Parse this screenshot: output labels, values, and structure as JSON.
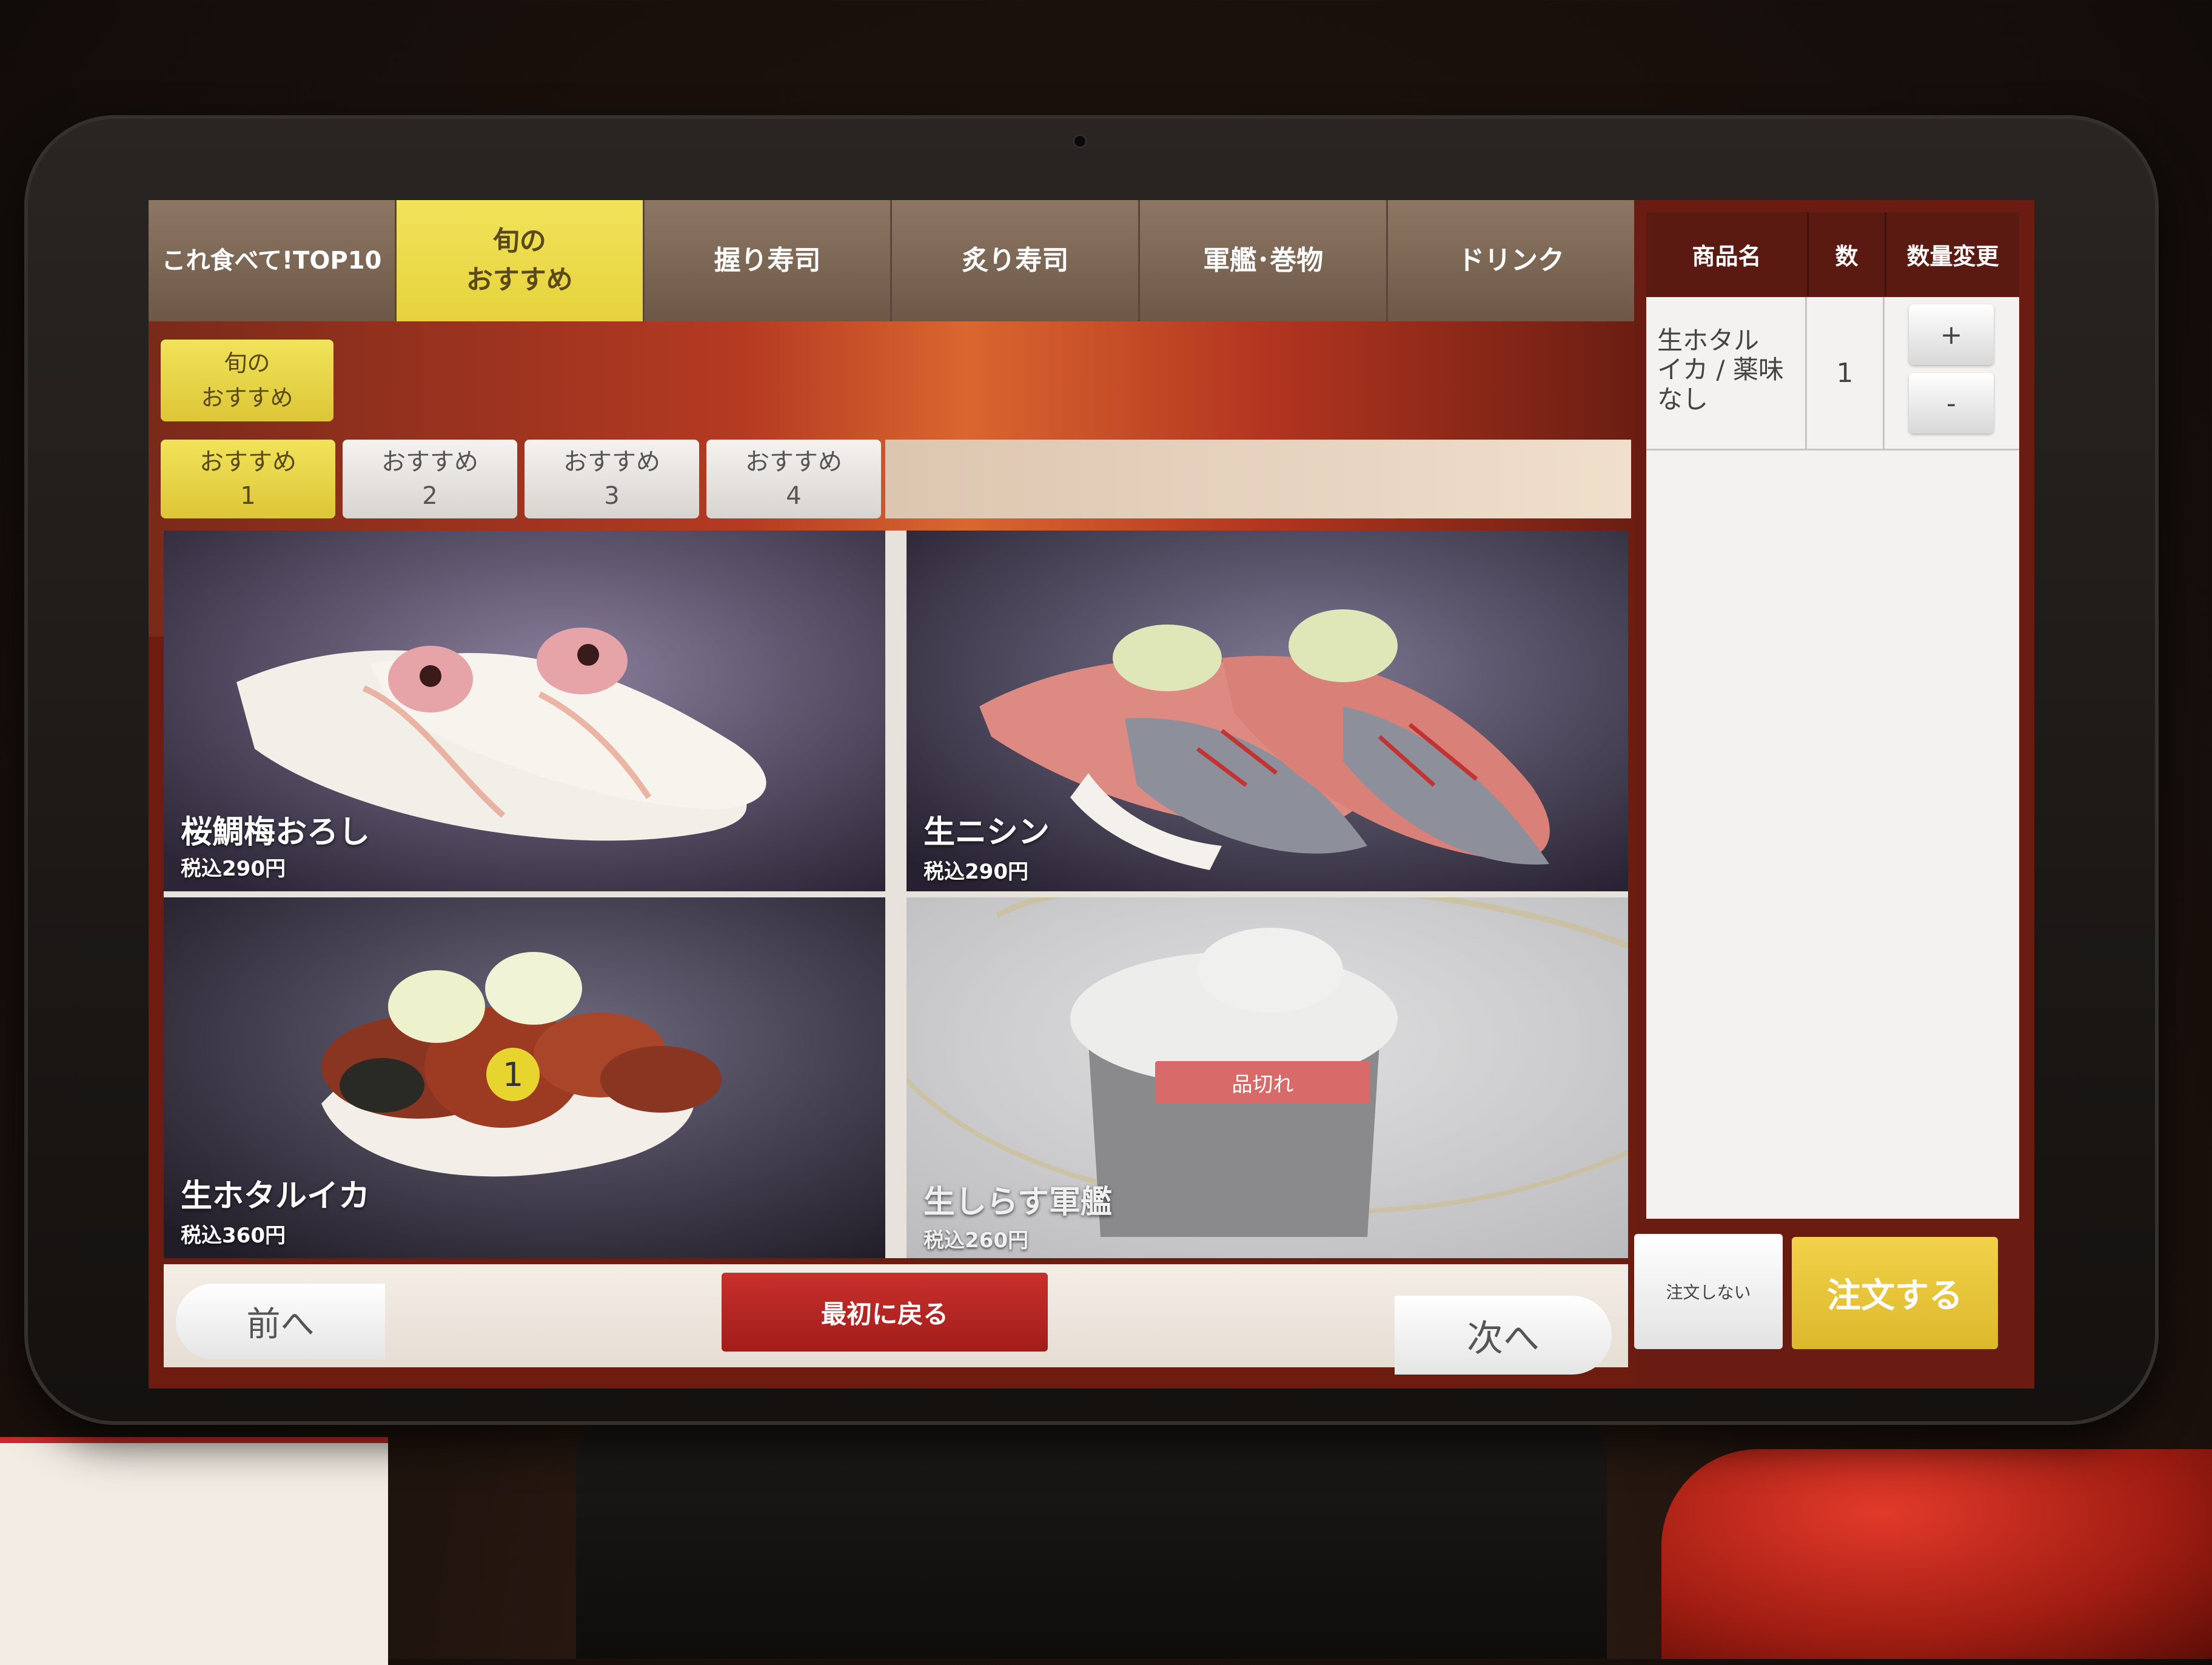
{
  "categories": [
    {
      "label": "これ食べて!TOP10",
      "active": false
    },
    {
      "label": "旬の\nおすすめ",
      "active": true
    },
    {
      "label": "握り寿司",
      "active": false
    },
    {
      "label": "炙り寿司",
      "active": false
    },
    {
      "label": "軍艦･巻物",
      "active": false
    },
    {
      "label": "ドリンク",
      "active": false
    }
  ],
  "sub_category": {
    "label": "旬の\nおすすめ"
  },
  "reco_tabs": [
    {
      "label": "おすすめ\n1",
      "active": true
    },
    {
      "label": "おすすめ\n2",
      "active": false
    },
    {
      "label": "おすすめ\n3",
      "active": false
    },
    {
      "label": "おすすめ\n4",
      "active": false
    }
  ],
  "items": [
    {
      "name": "桜鯛梅おろし",
      "price": "税込290円"
    },
    {
      "name": "生ニシン",
      "price": "税込290円"
    },
    {
      "name": "生ホタルイカ",
      "price": "税込360円",
      "ordered_count": "1"
    },
    {
      "name": "生しらす軍艦",
      "price": "税込260円",
      "status": "品切れ"
    }
  ],
  "nav": {
    "prev": "前へ",
    "top": "最初に戻る",
    "next": "次へ"
  },
  "cart": {
    "headers": {
      "name": "商品名",
      "qty": "数",
      "change": "数量変更"
    },
    "rows": [
      {
        "name": "生ホタル\nイカ / 薬味\nなし",
        "qty": "1",
        "plus": "+",
        "minus": "-"
      }
    ],
    "cancel": "注文しない",
    "order": "注文する"
  },
  "colors": {
    "accent_yellow": "#e6d23c",
    "brand_red": "#a11d1a",
    "order_gold": "#dcb82b"
  }
}
